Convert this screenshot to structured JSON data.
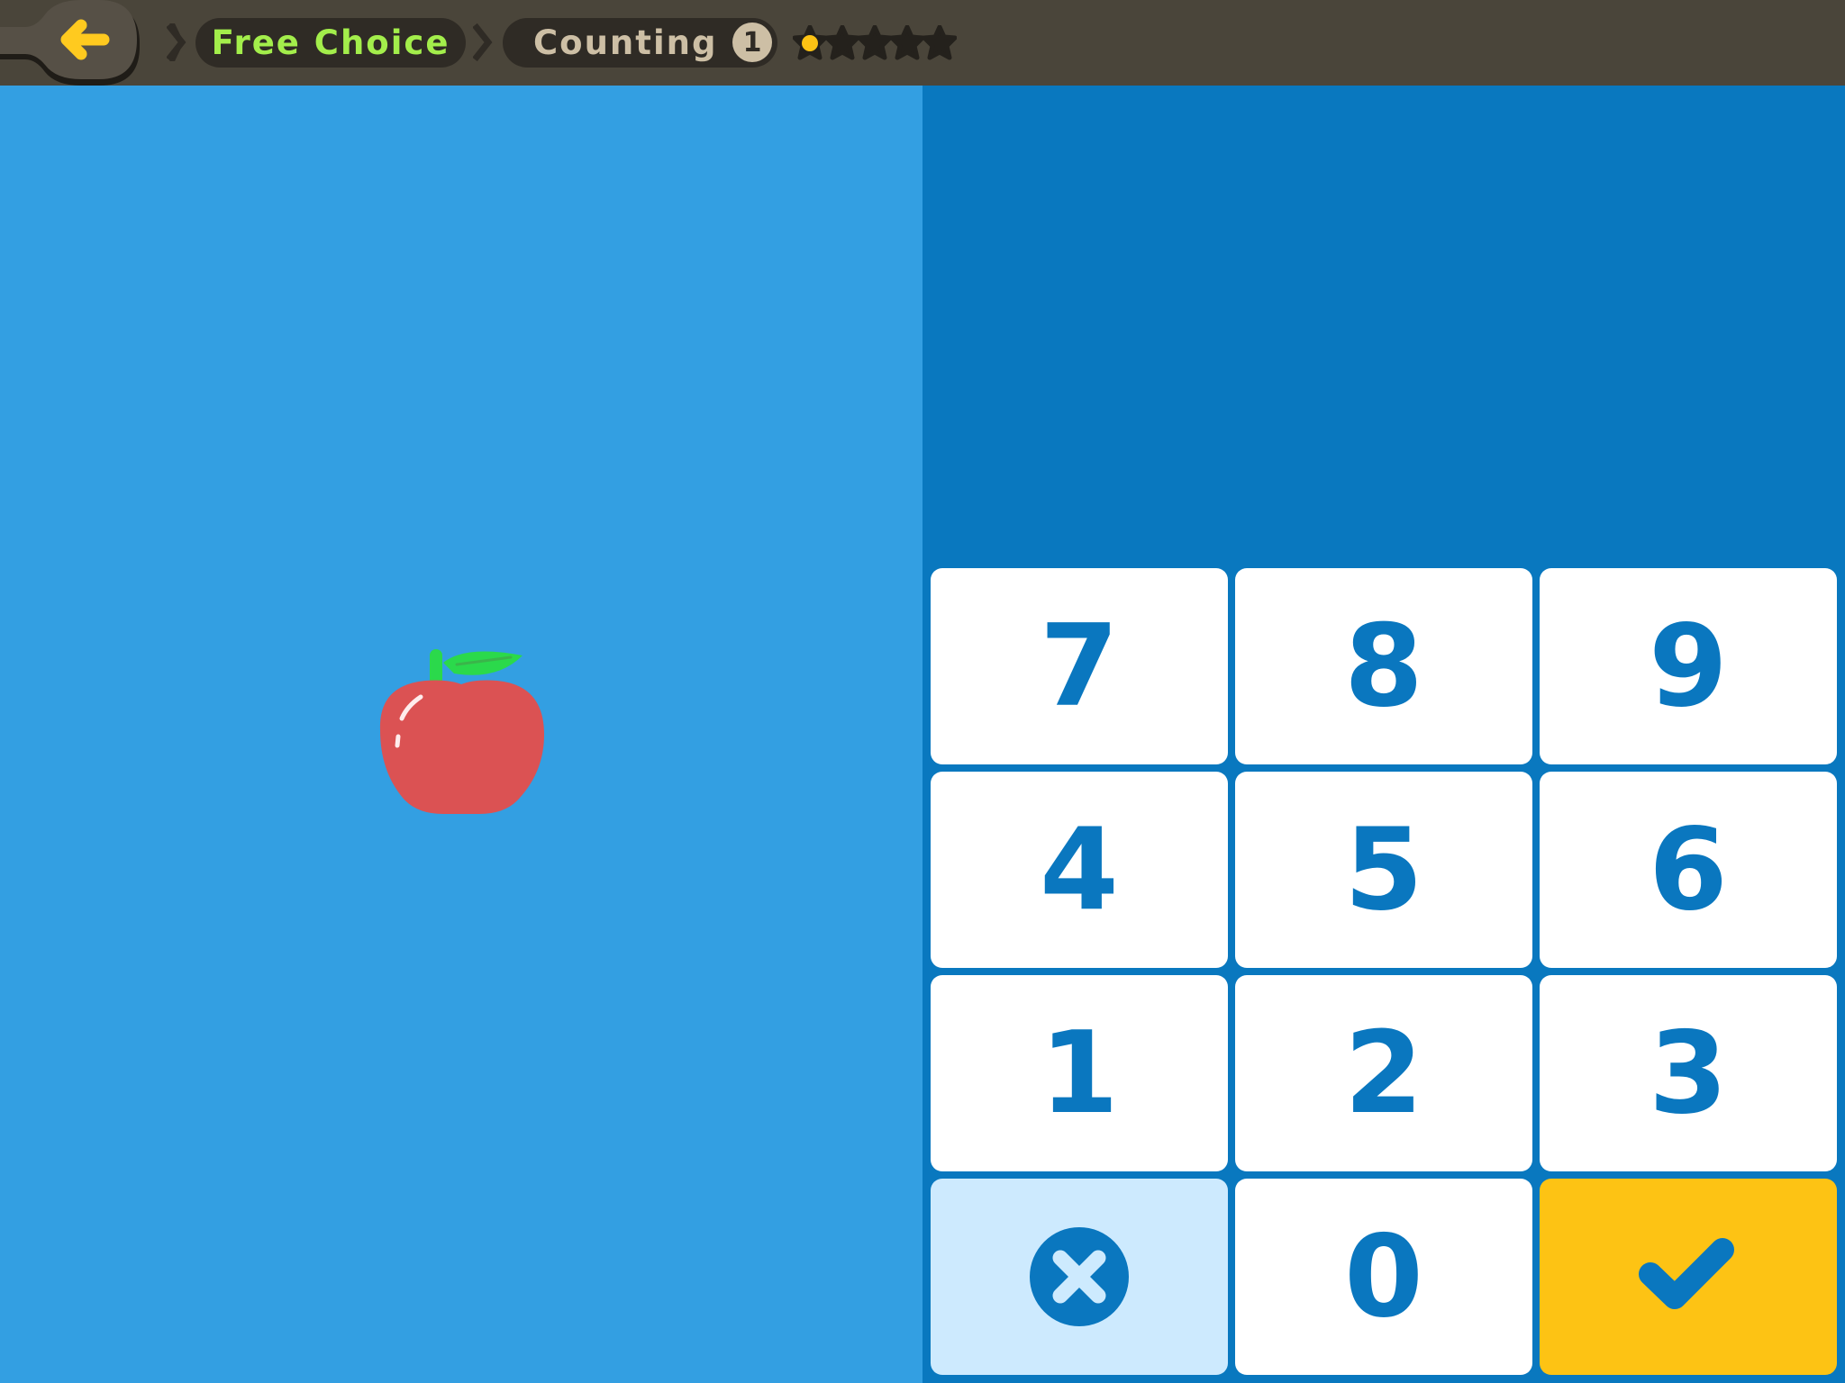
{
  "header": {
    "back_icon": "arrow-left-icon",
    "breadcrumb": [
      {
        "label": "Free Choice",
        "color": "#A3EE4B"
      },
      {
        "label": "Counting",
        "color": "#CDBFA5",
        "badge": "1"
      }
    ],
    "progress": {
      "total_stars": 5,
      "current_index": 1,
      "active_color": "#FDC314"
    }
  },
  "scene": {
    "objects": [
      {
        "type": "apple",
        "count": 1
      }
    ]
  },
  "answer": {
    "value": ""
  },
  "keypad": {
    "keys": [
      {
        "label": "7"
      },
      {
        "label": "8"
      },
      {
        "label": "9"
      },
      {
        "label": "4"
      },
      {
        "label": "5"
      },
      {
        "label": "6"
      },
      {
        "label": "1"
      },
      {
        "label": "2"
      },
      {
        "label": "3"
      },
      {
        "label": "",
        "icon": "clear-icon",
        "action": "clear"
      },
      {
        "label": "0"
      },
      {
        "label": "",
        "icon": "check-icon",
        "action": "submit"
      }
    ]
  },
  "colors": {
    "header_bg": "#4A453A",
    "left_bg": "#339FE2",
    "right_bg": "#0978BF",
    "key_text": "#0A77BF",
    "submit_bg": "#FDC314",
    "clear_bg": "#CDEAFE",
    "apple_red": "#DB5253",
    "leaf_green": "#2BD94B"
  }
}
